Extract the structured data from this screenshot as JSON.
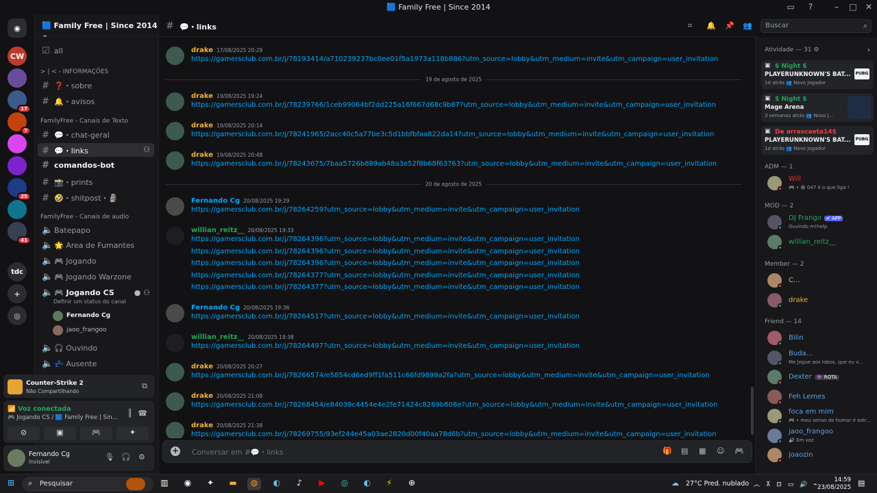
{
  "window": {
    "title": "🟦 Family Free | Since 2014"
  },
  "server": {
    "name": "🟦 Family Free | Since 2014"
  },
  "guilds": [
    {
      "label": "CW",
      "color": "#c0392b"
    },
    {
      "label": "",
      "color": "#6a4c9c"
    },
    {
      "label": "",
      "color": "#3b5b8c",
      "badge": "17"
    },
    {
      "label": "",
      "color": "#c2410c",
      "badge": "7"
    },
    {
      "label": "",
      "color": "#d946ef"
    },
    {
      "label": "",
      "color": "#7e22ce"
    },
    {
      "label": "",
      "color": "#1e3a8a",
      "badge": "25"
    },
    {
      "label": "",
      "color": "#0e7490"
    },
    {
      "label": "",
      "color": "#374151",
      "badge": "41"
    }
  ],
  "guild_tdc": "tdc",
  "sidebar": {
    "all": "all",
    "cat_info": "> | < - INFORMAÇÕES",
    "sobre": "❓・sobre",
    "avisos": "🔔・avisos",
    "cat_text": "FamilyFree - Canais de Texto",
    "chat_geral": "💬・chat-geral",
    "links": "💬・links",
    "comandos": "comandos-bot",
    "prints": "📸・prints",
    "shitpost": "🤣・shitpost・🗿",
    "cat_audio": "FamilyFree - Canais de audio",
    "batepapo": "Batepapo",
    "fumantes": "🌟 Area de Fumantes",
    "jogando": "🎮 Jogando",
    "warzone": "🎮 Jogando Warzone",
    "jogando_cs": "🎮 Jogando CS",
    "status_hint": "Definir um status do canal",
    "voice_users": [
      "Fernando Cg",
      "jaoo_frangoo"
    ],
    "ouvindo": "🎧 Ouvindo",
    "ausente": "💤 Ausente"
  },
  "activity": {
    "game": "Counter-Strike 2",
    "status": "Não Compartilhando"
  },
  "voice": {
    "status": "Voz conectada",
    "channel": "Jogando CS / 🟦 Family Free | Sin..."
  },
  "user": {
    "name": "Fernando Cg",
    "status": "Invisível"
  },
  "channel": {
    "name": "💬・links"
  },
  "search": {
    "placeholder": "Buscar"
  },
  "messages": [
    {
      "type": "msg",
      "author": "drake",
      "color": "#f0b232",
      "ts": "17/08/2025 20:29",
      "links": [
        "https://gamersclub.com.br/j/78193414/a710239237bc0ee01f5a1973a118b886?utm_source=lobby&utm_medium=invite&utm_campaign=user_invitation"
      ]
    },
    {
      "type": "divider",
      "text": "19 de agosto de 2025"
    },
    {
      "type": "msg",
      "author": "drake",
      "color": "#f0b232",
      "ts": "19/08/2025 19:24",
      "links": [
        "https://gamersclub.com.br/j/78239766/1ceb99064bf2dd225a16f667d68c9b87?utm_source=lobby&utm_medium=invite&utm_campaign=user_invitation"
      ]
    },
    {
      "type": "msg",
      "author": "drake",
      "color": "#f0b232",
      "ts": "19/08/2025 20:14",
      "links": [
        "https://gamersclub.com.br/j/78241965/2acc40c5a77be3c5d1bbfbfaa822da14?utm_source=lobby&utm_medium=invite&utm_campaign=user_invitation"
      ]
    },
    {
      "type": "msg",
      "author": "drake",
      "color": "#f0b232",
      "ts": "19/08/2025 20:48",
      "links": [
        "https://gamersclub.com.br/j/78243675/7baa5726b889ab48a3e52f8b68f63763?utm_source=lobby&utm_medium=invite&utm_campaign=user_invitation"
      ]
    },
    {
      "type": "divider",
      "text": "20 de agosto de 2025"
    },
    {
      "type": "msg",
      "author": "Fernando Cg",
      "color": "#00a8fc",
      "ts": "20/08/2025 19:29",
      "links": [
        "https://gamersclub.com.br/j/78264259?utm_source=lobby&utm_medium=invite&utm_campaign=user_invitation"
      ]
    },
    {
      "type": "msg",
      "author": "willian_reitz__",
      "color": "#23a55a",
      "ts": "20/08/2025 19:33",
      "links": [
        "https://gamersclub.com.br/j/78264396?utm_source=lobby&utm_medium=invite&utm_campaign=user_invitation",
        "https://gamersclub.com.br/j/78264396?utm_source=lobby&utm_medium=invite&utm_campaign=user_invitation",
        "https://gamersclub.com.br/j/78264396?utm_source=lobby&utm_medium=invite&utm_campaign=user_invitation",
        "https://gamersclub.com.br/j/78264377?utm_source=lobby&utm_medium=invite&utm_campaign=user_invitation",
        "https://gamersclub.com.br/j/78264377?utm_source=lobby&utm_medium=invite&utm_campaign=user_invitation"
      ]
    },
    {
      "type": "msg",
      "author": "Fernando Cg",
      "color": "#00a8fc",
      "ts": "20/08/2025 19:36",
      "links": [
        "https://gamersclub.com.br/j/78264517?utm_source=lobby&utm_medium=invite&utm_campaign=user_invitation"
      ]
    },
    {
      "type": "msg",
      "author": "willian_reitz__",
      "color": "#23a55a",
      "ts": "20/08/2025 19:38",
      "links": [
        "https://gamersclub.com.br/j/78264497?utm_source=lobby&utm_medium=invite&utm_campaign=user_invitation"
      ]
    },
    {
      "type": "msg",
      "author": "drake",
      "color": "#f0b232",
      "ts": "20/08/2025 20:27",
      "links": [
        "https://gamersclub.com.br/j/78266574/e5854cd6ed9ff1fa511c66fd9899a2fa?utm_source=lobby&utm_medium=invite&utm_campaign=user_invitation"
      ]
    },
    {
      "type": "msg",
      "author": "drake",
      "color": "#f0b232",
      "ts": "20/08/2025 21:08",
      "links": [
        "https://gamersclub.com.br/j/78268454/e84039c4454e4e2fe71424c8269b808e?utm_source=lobby&utm_medium=invite&utm_campaign=user_invitation"
      ]
    },
    {
      "type": "msg",
      "author": "drake",
      "color": "#f0b232",
      "ts": "20/08/2025 21:38",
      "links": [
        "https://gamersclub.com.br/j/78269755/93ef244e45a03ae2820d00f40aa78d6b?utm_source=lobby&utm_medium=invite&utm_campaign=user_invitation"
      ]
    }
  ],
  "composer": {
    "placeholder": "Conversar em #💬・links"
  },
  "members": {
    "activity_header": "Atividade — 31",
    "activity_cards": [
      {
        "user": "$ Night $",
        "game": "PLAYERUNKNOWN'S BAT...",
        "meta": "1d atrás  👥 Novo Jogador",
        "logo": "PUBG"
      },
      {
        "user": "$ Night $",
        "game": "Mage Arena",
        "meta": "3 semanas atrás  👥 Novo J...",
        "logo": ""
      },
      {
        "user": "De arrascaeta14$",
        "game": "PLAYERUNKNOWN'S BAT...",
        "meta": "1d atrás  👥 Novo Jogador",
        "logo": "PUBG"
      }
    ],
    "adm_header": "ADM — 1",
    "adm": [
      {
        "name": "Will",
        "color": "#e03131",
        "sub": "🎮 • 😁 047 é o que liga !",
        "status": "#f23f43"
      }
    ],
    "mod_header": "MOD — 2",
    "mod": [
      {
        "name": "DJ Frango",
        "color": "#23a55a",
        "sub": "Ouvindo m!help",
        "status": "#23a55a",
        "tag": "✔ APP"
      },
      {
        "name": "willian_reitz__",
        "color": "#23a55a",
        "sub": "",
        "status": "#23a55a"
      }
    ],
    "member_header": "Member — 2",
    "member": [
      {
        "name": "C...",
        "color": "#f0b232",
        "sub": "",
        "status": "#f23f43"
      },
      {
        "name": "drake",
        "color": "#f0b232",
        "sub": "",
        "status": "#23a55a"
      }
    ],
    "friend_header": "Friend — 14",
    "friend": [
      {
        "name": "Bilin",
        "color": "#5ba4e6",
        "sub": "",
        "status": "#23a55a"
      },
      {
        "name": "Buda...",
        "color": "#5ba4e6",
        "sub": "Me Jogue aos lobos, que eu v...",
        "status": "#23a55a"
      },
      {
        "name": "Dexter",
        "color": "#5ba4e6",
        "sub": "",
        "status": "#f23f43",
        "tag": "👾 ROTA"
      },
      {
        "name": "Feh Lemes",
        "color": "#5ba4e6",
        "sub": "",
        "status": "#f23f43"
      },
      {
        "name": "foca em mim",
        "color": "#5ba4e6",
        "sub": "🎮 • meu senso de humor é estr...",
        "status": "#23a55a"
      },
      {
        "name": "jaoo_frangoo",
        "color": "#5ba4e6",
        "sub": "🔊 Em voz",
        "status": "#23a55a"
      },
      {
        "name": "joaozin",
        "color": "#5ba4e6",
        "sub": "",
        "status": "#f23f43"
      }
    ]
  },
  "taskbar": {
    "search": "Pesquisar",
    "weather": "27°C  Pred. nublado",
    "time": "14:59",
    "date": "23/08/2025"
  }
}
